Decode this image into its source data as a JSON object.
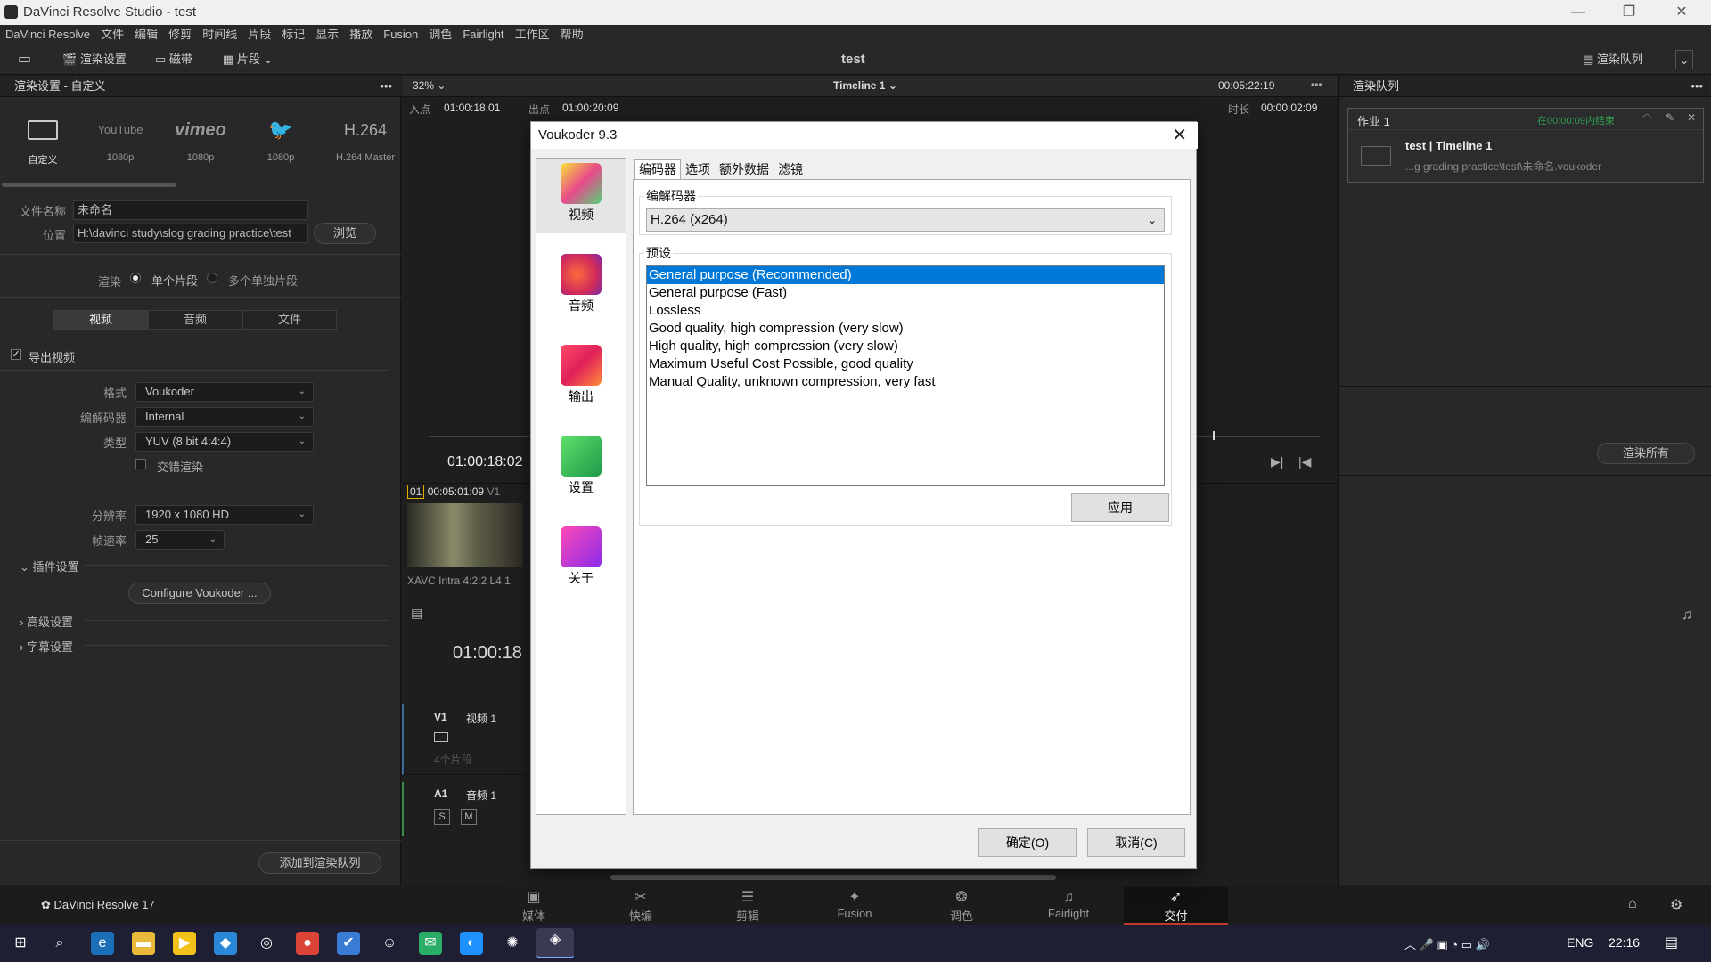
{
  "window": {
    "title": "DaVinci Resolve Studio - test",
    "min": "—",
    "max": "❐",
    "close": "✕"
  },
  "menu": [
    "DaVinci Resolve",
    "文件",
    "编辑",
    "修剪",
    "时间线",
    "片段",
    "标记",
    "显示",
    "播放",
    "Fusion",
    "调色",
    "Fairlight",
    "工作区",
    "帮助"
  ],
  "toolbar": {
    "render_settings": "渲染设置",
    "tape": "磁带",
    "clips": "片段",
    "project": "test",
    "render_queue": "渲染队列"
  },
  "left": {
    "header": "渲染设置 - 自定义",
    "presets": [
      {
        "name": "自定义",
        "sub": "自定义",
        "icon": "film-icon"
      },
      {
        "name": "YouTube",
        "sub": "1080p",
        "icon": "youtube-icon"
      },
      {
        "name": "vimeo",
        "sub": "1080p",
        "icon": "vimeo-icon"
      },
      {
        "name": "twitter",
        "sub": "1080p",
        "icon": "twitter-icon"
      },
      {
        "name": "H.264",
        "sub": "H.264 Master",
        "icon": "h264-icon"
      }
    ],
    "filename_label": "文件名称",
    "filename_value": "未命名",
    "location_label": "位置",
    "location_value": "H:\\davinci study\\slog grading practice\\test",
    "browse": "浏览",
    "render_label": "渲染",
    "render_single": "单个片段",
    "render_multi": "多个单独片段",
    "tabs": [
      "视频",
      "音频",
      "文件"
    ],
    "export_video": "导出视频",
    "format_label": "格式",
    "format_value": "Voukoder",
    "codec_label": "编解码器",
    "codec_value": "Internal",
    "type_label": "类型",
    "type_value": "YUV (8 bit 4:4:4)",
    "interlace": "交错渲染",
    "resolution_label": "分辨率",
    "resolution_value": "1920 x 1080 HD",
    "fps_label": "帧速率",
    "fps_value": "25",
    "plugin_settings": "插件设置",
    "configure": "Configure Voukoder ...",
    "advanced": "高级设置",
    "subtitle": "字幕设置",
    "add_queue": "添加到渲染队列"
  },
  "center": {
    "zoom": "32%",
    "timeline_name": "Timeline 1",
    "timecode_top": "00:05:22:19",
    "in_label": "入点",
    "in_value": "01:00:18:01",
    "out_label": "出点",
    "out_value": "01:00:20:09",
    "dur_label": "时长",
    "dur_value": "00:00:02:09",
    "playhead": "01:00:18:02",
    "clip_num": "01",
    "clip_tc": "00:05:01:09",
    "clip_track": "V1",
    "clip_codec": "XAVC Intra 4:2:2 L4.1",
    "timeline_tc": "01:00:18",
    "v1": "V1",
    "v1_name": "视频 1",
    "v1_clips": "4个片段",
    "a1": "A1",
    "a1_name": "音频 1",
    "solo": "S",
    "mute": "M"
  },
  "right": {
    "header": "渲染队列",
    "job_title": "作业 1",
    "job_status": "在00:00:09内结束",
    "job_name": "test | Timeline 1",
    "job_path": "...g grading practice\\test\\未命名.voukoder",
    "render_all": "渲染所有"
  },
  "pagenav": [
    "媒体",
    "快编",
    "剪辑",
    "Fusion",
    "调色",
    "Fairlight",
    "交付"
  ],
  "app_label": "DaVinci Resolve 17",
  "taskbar": {
    "lang": "ENG",
    "time": "22:16"
  },
  "dialog": {
    "title": "Voukoder 9.3",
    "nav": [
      "视频",
      "音频",
      "输出",
      "设置",
      "关于"
    ],
    "tabs": [
      "编码器",
      "选项",
      "额外数据",
      "滤镜"
    ],
    "codec_group": "编解码器",
    "codec_value": "H.264 (x264)",
    "preset_group": "预设",
    "presets": [
      "General purpose (Recommended)",
      "General purpose (Fast)",
      "Lossless",
      "Good quality, high compression (very slow)",
      "High quality, high compression (very slow)",
      "Maximum Useful Cost Possible, good quality",
      "Manual Quality, unknown compression, very fast"
    ],
    "apply": "应用",
    "ok": "确定(O)",
    "cancel": "取消(C)"
  },
  "colors": {
    "accent": "#0078d7",
    "delivery_active": "#c0392b",
    "job_green": "#2e9e4a"
  }
}
